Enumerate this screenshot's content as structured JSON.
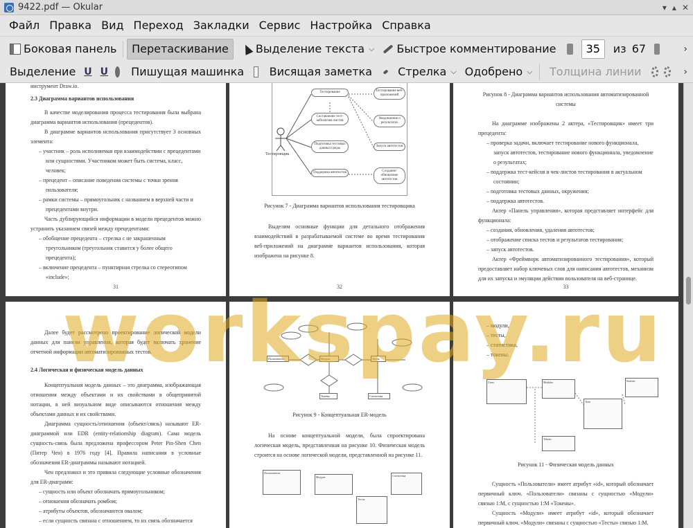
{
  "window": {
    "title": "9422.pdf  — Okular"
  },
  "menu": [
    "Файл",
    "Правка",
    "Вид",
    "Переход",
    "Закладки",
    "Сервис",
    "Настройка",
    "Справка"
  ],
  "toolbar1": {
    "sidebar": "Боковая панель",
    "drag": "Перетаскивание",
    "text_select": "Выделение текста",
    "quick_comment": "Быстрое комментирование",
    "page_current": "35",
    "page_of": "из",
    "page_total": "67"
  },
  "toolbar2": {
    "highlight": "Выделение",
    "typewriter": "Пишущая машинка",
    "note": "Висящая заметка",
    "arrow": "Стрелка",
    "approved": "Одобрено",
    "line_width": "Толщина линии"
  },
  "watermark": "workspay.ru",
  "pages": {
    "p31": {
      "intro": "инструмент Draw.io.",
      "heading": "2.3 Диаграмма вариантов использования",
      "para1": "В качестве моделирования процесса тестирования была выбрана диаграмма вариантов использования (прецедентов).",
      "para2": "В диаграмме вариантов использования присутствует 3 основных элемента:",
      "items": [
        "участник – роль исполняемая при взаимодействии с прецедентами или сущностями. Участником может быть система, класс, человек;",
        "прецедент – описание поведения системы с точки зрения пользователя;",
        "рамки системы – прямоугольник с названием в верхней части и прецедентами внутри."
      ],
      "para3": "Часть дублирующийся информации в модели прецедентов можно устранить указанием связей между прецедентами:",
      "items2": [
        "обобщение прецедента – стрелка с не закрашенным треугольником (треугольник ставится у более общего прецедента);",
        "включение прецедента – пунктирная стрелка со стереотипом «include»;"
      ],
      "num": "31"
    },
    "p32": {
      "actor": "Тестировщик",
      "cases": [
        "Тестирование",
        "Составление тест-кейсов/чек-листов",
        "Подготовка тестовых данных/среды",
        "Поддержка автотестов"
      ],
      "right_cases": [
        "Тестирование веб-приложений",
        "Уведомление о результатах",
        "Запуск автотестов",
        "Создание/обновление автотестов"
      ],
      "caption": "Рисунок 7 - Диаграмма вариантов использования тестировщика",
      "para": "Выделим основные функции для детального отображения взаимодействий в разрабатываемой системе во время тестирования веб-приложений на диаграмме вариантов использования, которая изображена на рисунке 8.",
      "num": "32"
    },
    "p33": {
      "caption": "Рисунок 8 - Диаграмма вариантов использования автоматизированной системы",
      "para1": "На диаграмме изображены 2 актера, «Тестировщик» имеет три прецедента:",
      "items1": [
        "проверка задачи, включает тестирование нового функционала, запуск автотестов, тестирование нового функционала, уведомление о результатах;",
        "поддержка тест-кейсов и чек-листов тестирования в актуальном состоянии;",
        "подготовка тестовых данных, окружения;",
        "поддержка автотестов."
      ],
      "para2": "Актер «Панель управления», которая представляет интерфейс для функционала:",
      "items2": [
        "создания, обновления, удаления автотестов;",
        "отображение списка тестов и результатов тестирования;",
        "запуск автотестов."
      ],
      "para3": "Актер «Фреймворк автоматизированного тестирования», который предоставляет набор ключевых слов для написания автотестов, механизм для их запуска и эмуляции действия пользователя на веб-странице.",
      "num": "33"
    },
    "p34": {
      "para1": "Далее будет рассмотрено проектирование логической модели данных для панели управления, которая будет включать хранение отчетной информации автоматизированных тестов.",
      "heading": "2.4 Логическая и физическая модель данных",
      "para2": "Концептуальная модель данных – это диаграмма, изображающая отношения между объектами и их свойствами в общепринятой нотации, в ней визуальном виде описываются отношения между объектами данных и их свойствами.",
      "para3": "Диаграмма сущность/отношения (объект/связь) называют ER-диаграммой или EDR (entity-relationship diagram). Сама модель сущность-связь была предложена профессором Peter Pin-Shen Chen (Питер Чен) в 1976 году [4]. Правила написания в условные обозначения ER-диаграммы называют нотацией.",
      "para4": "Чен предложил и это привила следующие условные обозначения для ER-диаграмм:",
      "items": [
        "сущность или объект обозначать прямоугольником;",
        "отношения обозначать ромбом;",
        "атрибуты объектов, обозначаются овалом;",
        "если сущность связана с отношением, то их связь обозначается тонкой линией со стрелкой. Необходимая связь обозначается"
      ]
    },
    "p35": {
      "caption": "Рисунок 9 - Концептуальная ER-модель",
      "para": "На основе концептуальной модели, была спроектирована логическая модель, представленная на рисунке 10. Физическая модель строится на основе логической модели, представленной на рисунке 11.",
      "er_entities": [
        "Пользователи",
        "Модули",
        "Тесты",
        "Токены",
        "Статистика"
      ],
      "tables": [
        "Пользователи",
        "Модули",
        "Тесты",
        "Статистика"
      ]
    },
    "p36": {
      "items": [
        "модули,",
        "тесты,",
        "статистика,",
        "токены."
      ],
      "caption": "Рисунок 11 - Физическая модель данных",
      "para1": "Сущность «Пользователи» имеет атрибут «id», который обозначает первичный ключ. «Пользователи» связаны с сущностью «Модули» связью 1:М, с сущностью 1:М «Токены».",
      "para2": "Сущность «Модули» имеет атрибут «id», который обозначает первичный ключ. «Модули» связаны с сущностью «Тесты» связью 1:М.",
      "tables": [
        "Users",
        "Modules",
        "Tests",
        "Tokens",
        "Statistic"
      ]
    }
  }
}
